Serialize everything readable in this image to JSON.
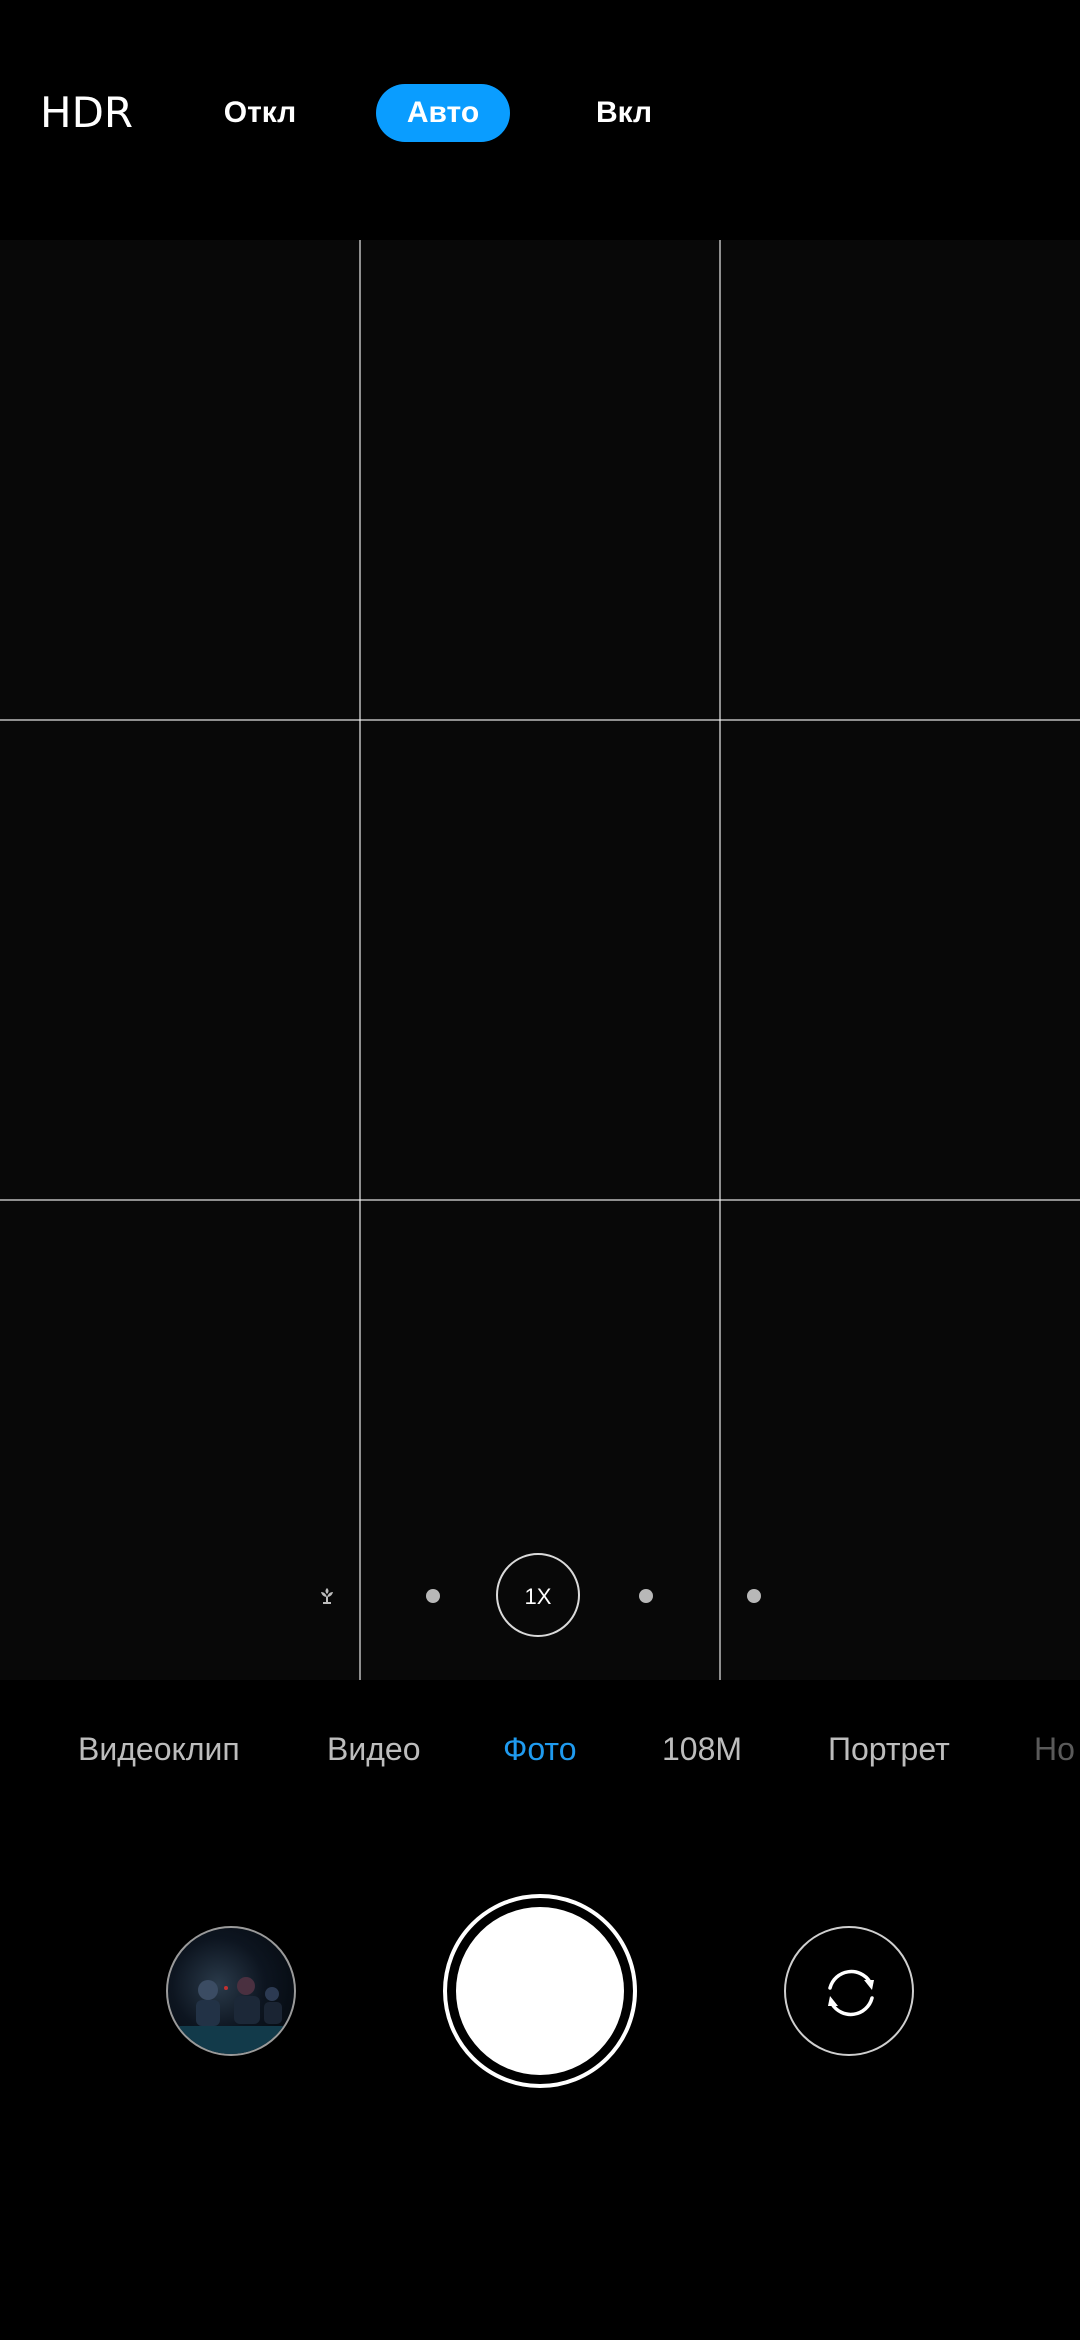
{
  "hdr": {
    "label": "HDR",
    "options": [
      {
        "label": "Откл",
        "selected": false
      },
      {
        "label": "Авто",
        "selected": true
      },
      {
        "label": "Вкл",
        "selected": false
      }
    ],
    "selected_color": "#0a9dff"
  },
  "viewfinder": {
    "grid": "3x3"
  },
  "zoom": {
    "current": "1X",
    "icons": [
      "macro-icon"
    ]
  },
  "modes": [
    {
      "label": "Видеоклип",
      "active": false
    },
    {
      "label": "Видео",
      "active": false
    },
    {
      "label": "Фото",
      "active": true
    },
    {
      "label": "108M",
      "active": false
    },
    {
      "label": "Портрет",
      "active": false
    },
    {
      "label": "Но",
      "active": false
    }
  ],
  "controls": {
    "gallery": "gallery-thumbnail",
    "shutter": "shutter-button",
    "switch": "switch-camera-icon"
  },
  "colors": {
    "accent": "#1f9bf0",
    "background": "#000000"
  }
}
